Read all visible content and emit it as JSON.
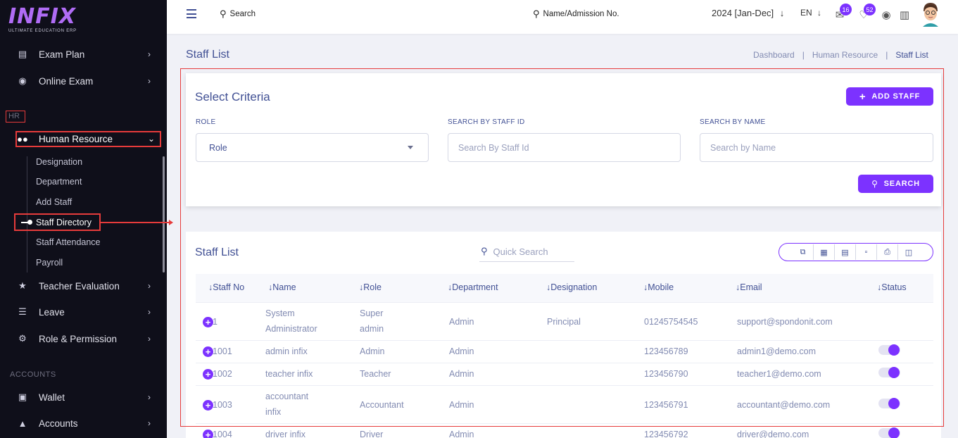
{
  "brand": {
    "logo_text": "INFIX",
    "tagline": "ULTIMATE EDUCATION ERP"
  },
  "sidebar": {
    "items_top": [
      {
        "label": "Exam Plan",
        "icon": "clipboard-icon"
      },
      {
        "label": "Online Exam",
        "icon": "globe-icon"
      }
    ],
    "section_hr": "HR",
    "human_resource": "Human Resource",
    "sub_items": [
      "Designation",
      "Department",
      "Add Staff",
      "Staff Directory",
      "Staff Attendance",
      "Payroll"
    ],
    "items_bottom": [
      {
        "label": "Teacher Evaluation",
        "icon": "star-icon"
      },
      {
        "label": "Leave",
        "icon": "leave-icon"
      },
      {
        "label": "Role & Permission",
        "icon": "permission-icon"
      }
    ],
    "section_accounts": "ACCOUNTS",
    "items_accounts": [
      {
        "label": "Wallet",
        "icon": "wallet-icon"
      },
      {
        "label": "Accounts",
        "icon": "bank-icon"
      }
    ]
  },
  "header": {
    "search_label": "Search",
    "search_admission": "Name/Admission No.",
    "year": "2024 [Jan-Dec]",
    "language": "EN",
    "messages_count": "16",
    "notifications_count": "52"
  },
  "page": {
    "title": "Staff List",
    "breadcrumb": [
      "Dashboard",
      "Human Resource",
      "Staff List"
    ]
  },
  "criteria": {
    "title": "Select Criteria",
    "add_staff": "ADD STAFF",
    "role_label": "ROLE",
    "role_value": "Role",
    "staff_id_label": "SEARCH BY STAFF ID",
    "staff_id_placeholder": "Search By Staff Id",
    "name_label": "SEARCH BY NAME",
    "name_placeholder": "Search by Name",
    "search_button": "SEARCH"
  },
  "staff_list": {
    "title": "Staff List",
    "quick_search_placeholder": "Quick Search",
    "columns": [
      "Staff No",
      "Name",
      "Role",
      "Department",
      "Designation",
      "Mobile",
      "Email",
      "Status"
    ],
    "rows": [
      {
        "no": "1",
        "name": "System Administrator",
        "role": "Super admin",
        "department": "Admin",
        "designation": "Principal",
        "mobile": "01245754545",
        "email": "support@spondonit.com",
        "status": false
      },
      {
        "no": "1001",
        "name": "admin infix",
        "role": "Admin",
        "department": "Admin",
        "designation": "",
        "mobile": "123456789",
        "email": "admin1@demo.com",
        "status": true
      },
      {
        "no": "1002",
        "name": "teacher infix",
        "role": "Teacher",
        "department": "Admin",
        "designation": "",
        "mobile": "123456790",
        "email": "teacher1@demo.com",
        "status": true
      },
      {
        "no": "1003",
        "name": "accountant infix",
        "role": "Accountant",
        "department": "Admin",
        "designation": "",
        "mobile": "123456791",
        "email": "accountant@demo.com",
        "status": true
      },
      {
        "no": "1004",
        "name": "driver infix",
        "role": "Driver",
        "department": "Admin",
        "designation": "",
        "mobile": "123456792",
        "email": "driver@demo.com",
        "status": true
      }
    ]
  },
  "colors": {
    "accent": "#7c32ff",
    "sidebar_bg": "#0f0f1a",
    "annotation": "#e63b3b",
    "text_primary": "#415094",
    "text_muted": "#828bb2"
  }
}
